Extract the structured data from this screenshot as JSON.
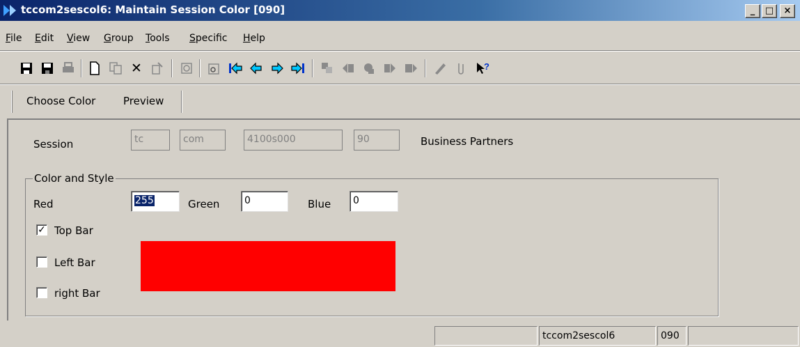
{
  "window": {
    "title": "tccom2sescol6: Maintain Session Color [090]",
    "controls": {
      "minimize": "_",
      "maximize": "□",
      "close": "×"
    }
  },
  "menubar": [
    "File",
    "Edit",
    "View",
    "Group",
    "Tools",
    "Specific",
    "Help"
  ],
  "toolbar": {
    "icons": [
      "save-and-exit-icon",
      "save-icon",
      "print-icon",
      "new-icon",
      "copy-icon",
      "delete-icon",
      "change-icon",
      "refresh-icon",
      "find-icon",
      "first-record-icon",
      "previous-record-icon",
      "next-record-icon",
      "last-record-icon",
      "group-first-icon",
      "group-previous-icon",
      "group-current-icon",
      "group-next-icon",
      "group-last-icon",
      "edit-text-icon",
      "attachment-icon",
      "help-pointer-icon"
    ]
  },
  "tabs": [
    "Choose Color",
    "Preview"
  ],
  "session": {
    "label": "Session",
    "package": "tc",
    "module": "com",
    "code": "4100s000",
    "version": "90",
    "description": "Business Partners"
  },
  "color_style": {
    "legend": "Color and Style",
    "red_label": "Red",
    "red_value": "255",
    "green_label": "Green",
    "green_value": "0",
    "blue_label": "Blue",
    "blue_value": "0",
    "top_bar_label": "Top Bar",
    "top_bar_checked": true,
    "left_bar_label": "Left Bar",
    "left_bar_checked": false,
    "right_bar_label": "right Bar",
    "right_bar_checked": false,
    "preview_color": "#ff0000"
  },
  "statusbar": {
    "session": "tccom2sescol6",
    "company": "090"
  },
  "colors": {
    "titlebar_start": "#0a246a",
    "titlebar_end": "#a6caf0",
    "face": "#d4d0c8"
  }
}
